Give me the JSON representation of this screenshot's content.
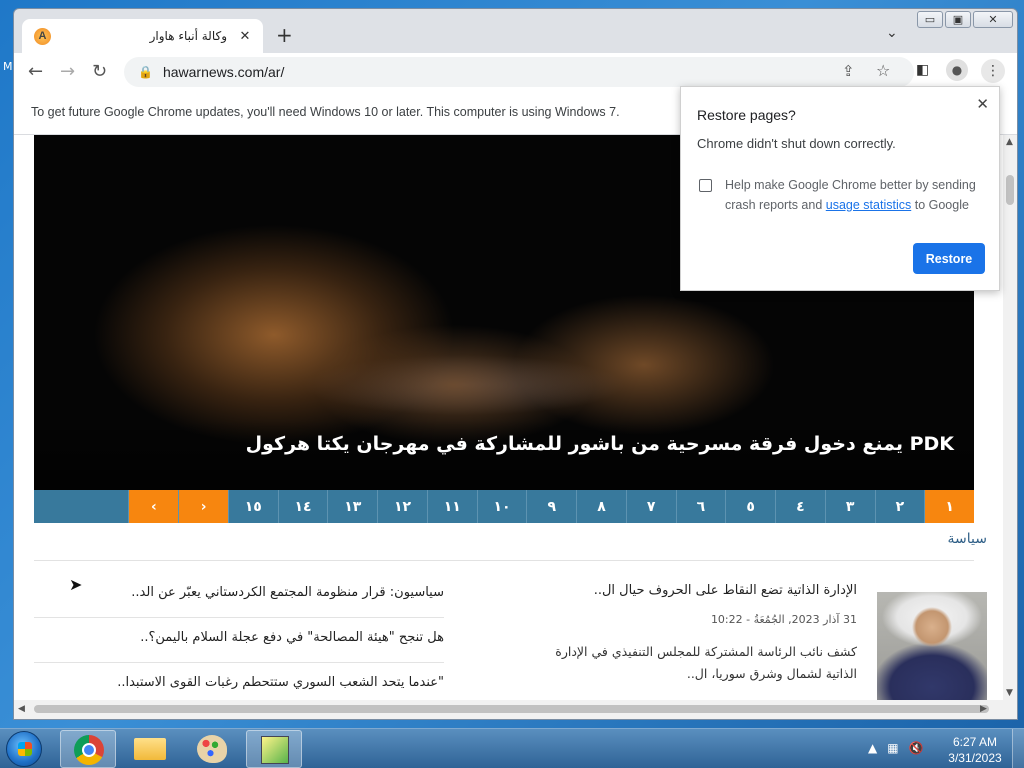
{
  "browser": {
    "tab_title": "وكالة أنباء هاوار",
    "favicon_letter": "A",
    "url": "hawarnews.com/ar/",
    "update_notice": "To get future Google Chrome updates, you'll need Windows 10 or later. This computer is using Windows 7."
  },
  "page": {
    "hero_title": "PDK يمنع دخول فرقة مسرحية من باشور للمشاركة في مهرجان يكتا هركول",
    "pager": [
      "١٥",
      "١٤",
      "١٣",
      "١٢",
      "١١",
      "١٠",
      "٩",
      "٨",
      "٧",
      "٦",
      "٥",
      "٤",
      "٣",
      "٢",
      "١"
    ],
    "pager_prev": "‹",
    "pager_next": "›",
    "section_label": "سياسة",
    "news_left": [
      "سياسيون: قرار منظومة المجتمع الكردستاني يعبّر عن الد..",
      "هل تنجح \"هيئة المصالحة\" في دفع عجلة السلام باليمن؟..",
      "\"عندما يتحد الشعب السوري ستتحطم رغبات القوى الاستبدا.."
    ],
    "feature": {
      "title": "الإدارة الذاتية تضع النقاط على الحروف حيال ال..",
      "date": "31 آذار 2023, الجُمُعَةُ - 10:22",
      "body": "كشف نائب الرئاسة المشتركة للمجلس التنفيذي في الإدارة الذاتية لشمال وشرق سوريا، ال.."
    }
  },
  "popup": {
    "title": "Restore pages?",
    "message": "Chrome didn't shut down correctly.",
    "checkbox_text_before": "Help make Google Chrome better by sending crash reports and",
    "checkbox_link": "usage statistics",
    "checkbox_text_after": "to Google",
    "restore_label": "Restore"
  },
  "taskbar": {
    "time": "6:27 AM",
    "date": "3/31/2023"
  },
  "colors": {
    "accent_orange": "#f7860f",
    "pager_blue": "#38799c",
    "chrome_blue": "#1a73e8"
  }
}
